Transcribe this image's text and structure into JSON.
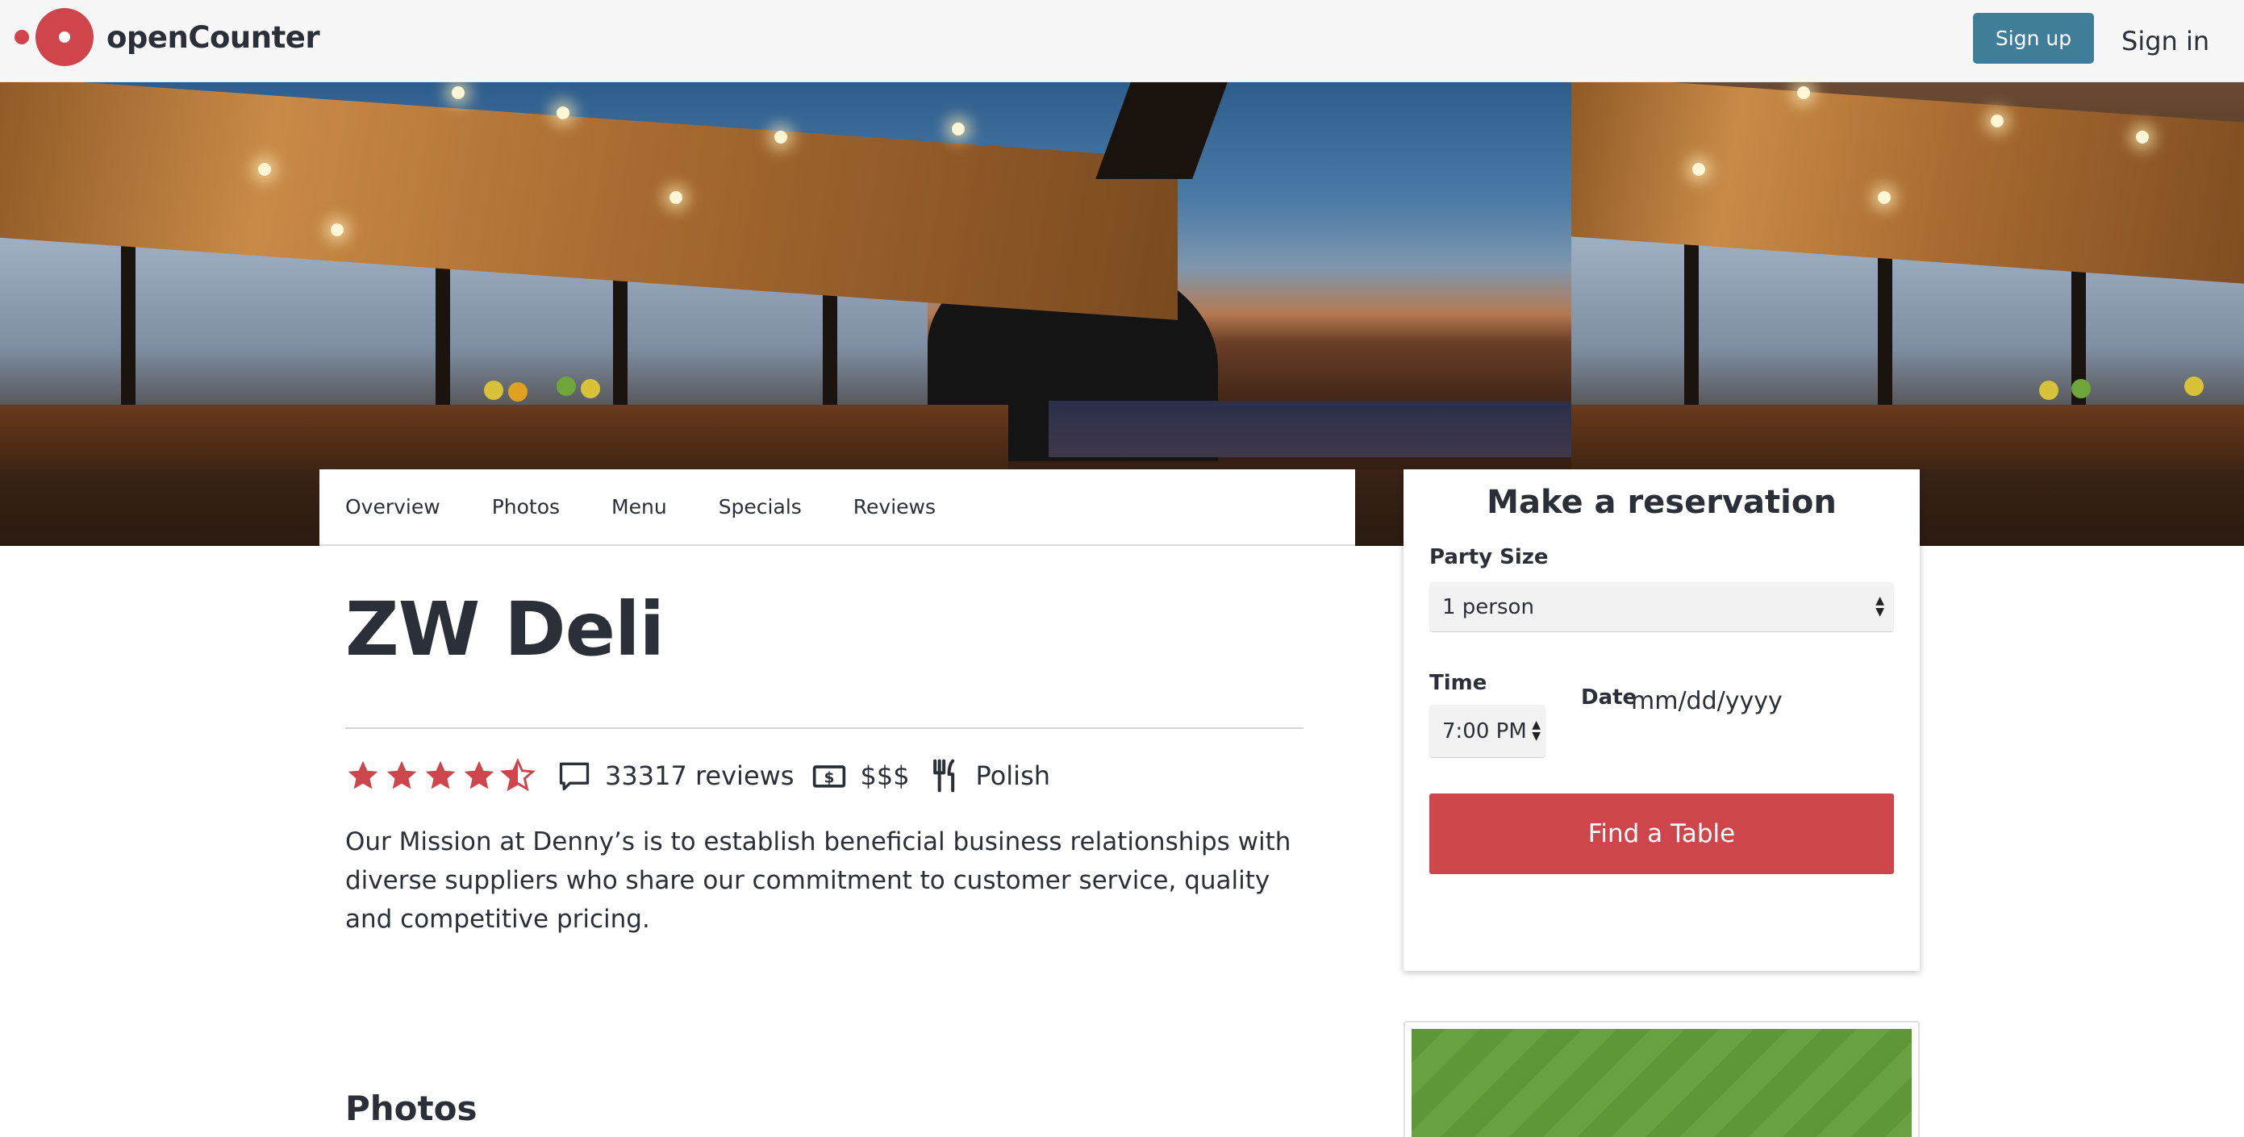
{
  "header": {
    "brand": "openCounter",
    "signup_label": "Sign up",
    "signin_label": "Sign in"
  },
  "tabs": [
    {
      "label": "Overview"
    },
    {
      "label": "Photos"
    },
    {
      "label": "Menu"
    },
    {
      "label": "Specials"
    },
    {
      "label": "Reviews"
    }
  ],
  "restaurant": {
    "name": "ZW Deli",
    "rating": 4.5,
    "rating_max": 5,
    "review_count": "33317 reviews",
    "price": "$$$",
    "cuisine": "Polish",
    "description": "Our Mission at Denny’s is to establish beneficial business relationships with diverse suppliers who share our commitment to customer service, quality and competitive pricing."
  },
  "sections": {
    "photos_heading": "Photos"
  },
  "reservation": {
    "title": "Make a reservation",
    "party_size_label": "Party Size",
    "party_size_value": "1 person",
    "time_label": "Time",
    "time_value": "7:00 PM",
    "date_label": "Date",
    "date_placeholder": "mm/dd/yyyy",
    "submit_label": "Find a Table"
  },
  "colors": {
    "brand_red": "#cf454c",
    "signup_blue": "#3f7d99",
    "text_dark": "#2b2f38"
  },
  "icons": {
    "star": "star-icon",
    "reviews": "speech-bubble-icon",
    "price": "money-icon",
    "cuisine": "utensils-icon"
  }
}
